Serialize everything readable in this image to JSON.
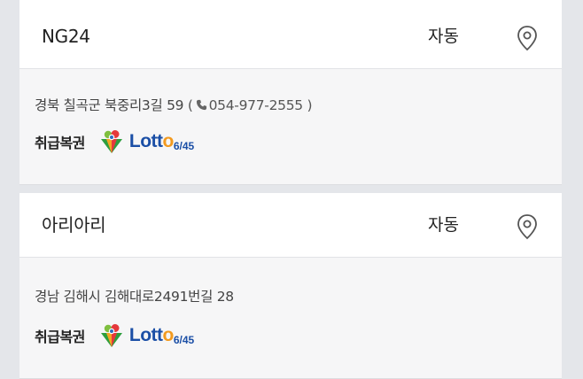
{
  "stores": [
    {
      "name": "NG24",
      "mode": "자동",
      "address": "경북 칠곡군 북중리3길 59",
      "phone_open": "(",
      "phone": "054-977-2555",
      "phone_close": ")",
      "sell_label": "취급복권",
      "lotto_logo": {
        "text_main": "Lott",
        "text_o": "o",
        "text_sub": "6/45"
      }
    },
    {
      "name": "아리아리",
      "mode": "자동",
      "address": "경남 김해시 김해대로2491번길 28",
      "sell_label": "취급복권",
      "lotto_logo": {
        "text_main": "Lott",
        "text_o": "o",
        "text_sub": "6/45"
      }
    }
  ],
  "icons": {
    "location": "map-pin-icon",
    "phone": "phone-icon"
  },
  "colors": {
    "background": "#e4e6ea",
    "card_body": "#f6f6f7",
    "card_head": "#ffffff",
    "lotto_blue": "#1b4fa6"
  }
}
